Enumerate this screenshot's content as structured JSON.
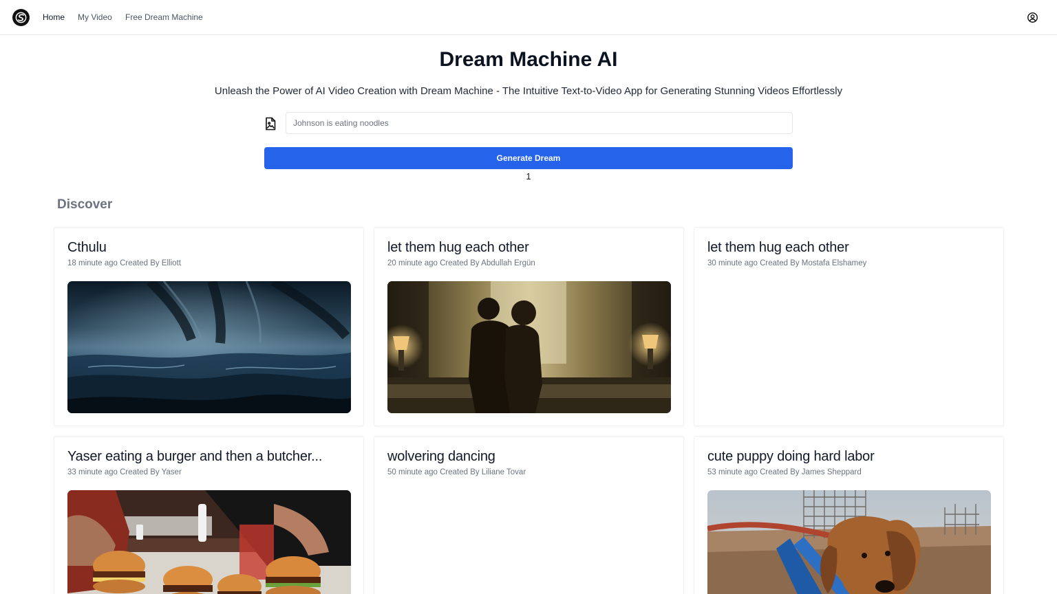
{
  "nav": {
    "logo_icon": "swirl-logo-icon",
    "links": [
      {
        "label": "Home",
        "active": true
      },
      {
        "label": "My Video",
        "active": false
      },
      {
        "label": "Free Dream Machine",
        "active": false
      }
    ],
    "user_icon": "user-circle-icon"
  },
  "hero": {
    "title": "Dream Machine AI",
    "subtitle": "Unleash the Power of AI Video Creation with Dream Machine - The Intuitive Text-to-Video App for Generating Stunning Videos Effortlessly"
  },
  "prompt": {
    "icon": "file-image-icon",
    "placeholder": "Johnson is eating noodles",
    "value": ""
  },
  "generate": {
    "label": "Generate Dream",
    "count": "1"
  },
  "discover": {
    "title": "Discover",
    "cards": [
      {
        "title": "Cthulu",
        "meta": "18 minute ago Created By Elliott",
        "has_thumbnail": true,
        "thumbnail": "stormy-sea-video-thumbnail"
      },
      {
        "title": "let them hug each other",
        "meta": "20 minute ago Created By Abdullah Ergün",
        "has_thumbnail": true,
        "thumbnail": "couple-embrace-video-thumbnail"
      },
      {
        "title": "let them hug each other",
        "meta": "30 minute ago Created By Mostafa Elshamey",
        "has_thumbnail": false
      },
      {
        "title": "Yaser eating a burger and then a butcher...",
        "meta": "33 minute ago Created By Yaser",
        "has_thumbnail": true,
        "thumbnail": "burgers-video-thumbnail"
      },
      {
        "title": "wolvering dancing",
        "meta": "50 minute ago Created By Liliane Tovar",
        "has_thumbnail": false
      },
      {
        "title": "cute puppy doing hard labor",
        "meta": "53 minute ago Created By James Sheppard",
        "has_thumbnail": true,
        "thumbnail": "puppy-construction-video-thumbnail"
      }
    ]
  },
  "colors": {
    "primary": "#2563eb",
    "text": "#111827",
    "muted": "#6b7280",
    "border": "#e5e7eb"
  }
}
